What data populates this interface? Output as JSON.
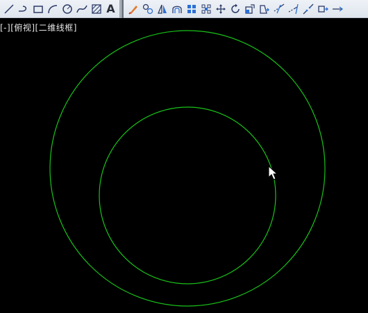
{
  "viewport": {
    "label": "[-][俯视][二维线框]"
  },
  "toolbar": {
    "draw_tools": [
      "line-icon",
      "polyline-icon",
      "rectangle-icon",
      "arc-icon",
      "circle-icon",
      "spline-icon",
      "hatch-icon"
    ],
    "text_tool_label": "A",
    "modify_tools": [
      "erase-icon",
      "copy-icon",
      "mirror-icon",
      "offset-icon",
      "array-icon",
      "array-alt-icon",
      "move-icon",
      "rotate-icon",
      "scale-icon",
      "stretch-icon",
      "trim-icon",
      "extend-icon",
      "break-icon",
      "explode-icon"
    ]
  },
  "drawing": {
    "entity_color": "#19c219",
    "background_color": "#000000",
    "entities": [
      "outer-circle",
      "inner-circle"
    ]
  }
}
